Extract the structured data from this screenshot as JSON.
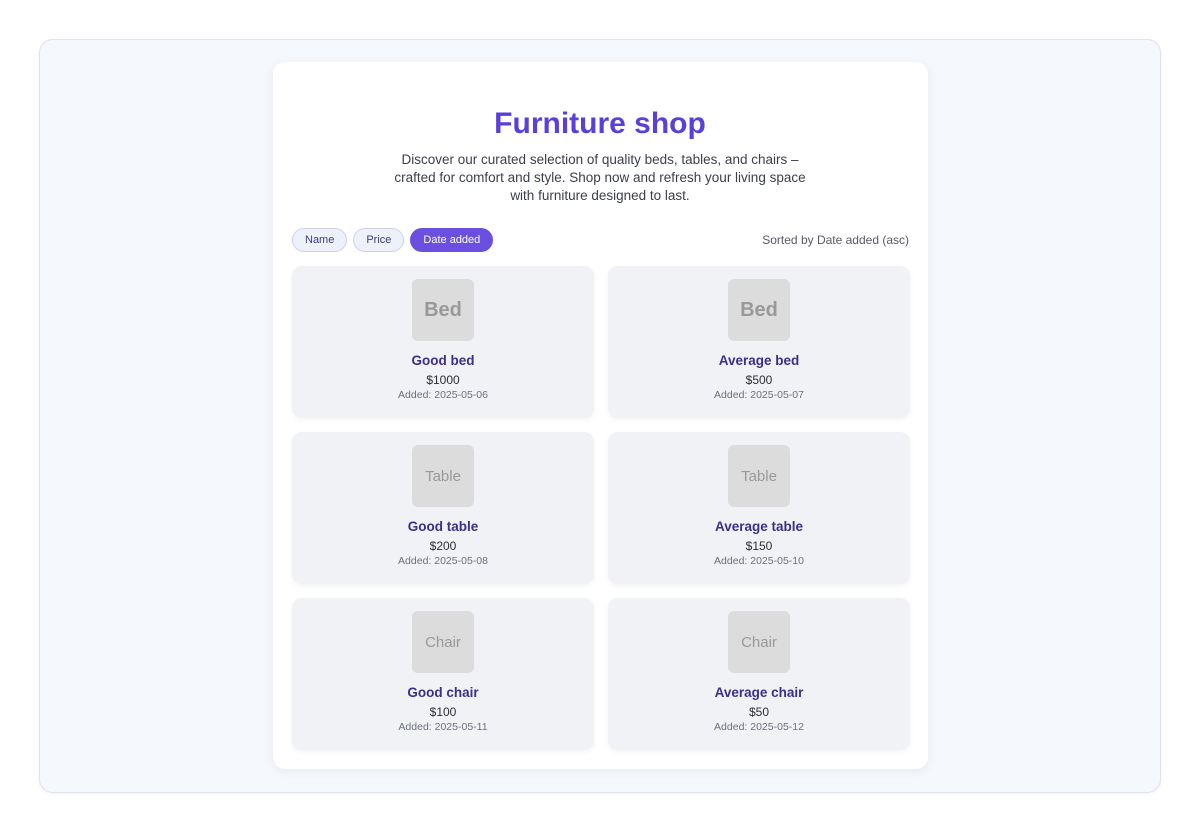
{
  "header": {
    "title": "Furniture shop",
    "intro": "Discover our curated selection of quality beds, tables, and chairs – crafted for comfort and style. Shop now and refresh your living space with furniture designed to last."
  },
  "sort": {
    "buttons": [
      {
        "label": "Name",
        "active": false
      },
      {
        "label": "Price",
        "active": false
      },
      {
        "label": "Date added",
        "active": true
      }
    ],
    "status": "Sorted by Date added (asc)"
  },
  "products": [
    {
      "thumb": "Bed",
      "name": "Good bed",
      "price": "$1000",
      "added": "Added: 2025-05-06"
    },
    {
      "thumb": "Bed",
      "name": "Average bed",
      "price": "$500",
      "added": "Added: 2025-05-07"
    },
    {
      "thumb": "Table",
      "name": "Good table",
      "price": "$200",
      "added": "Added: 2025-05-08"
    },
    {
      "thumb": "Table",
      "name": "Average table",
      "price": "$150",
      "added": "Added: 2025-05-10"
    },
    {
      "thumb": "Chair",
      "name": "Good chair",
      "price": "$100",
      "added": "Added: 2025-05-11"
    },
    {
      "thumb": "Chair",
      "name": "Average chair",
      "price": "$50",
      "added": "Added: 2025-05-12"
    }
  ],
  "colors": {
    "accent": "#5b3fd9",
    "active_button": "#6a4fe0",
    "card_bg": "#f1f2f5",
    "product_name": "#3b2f8a"
  }
}
